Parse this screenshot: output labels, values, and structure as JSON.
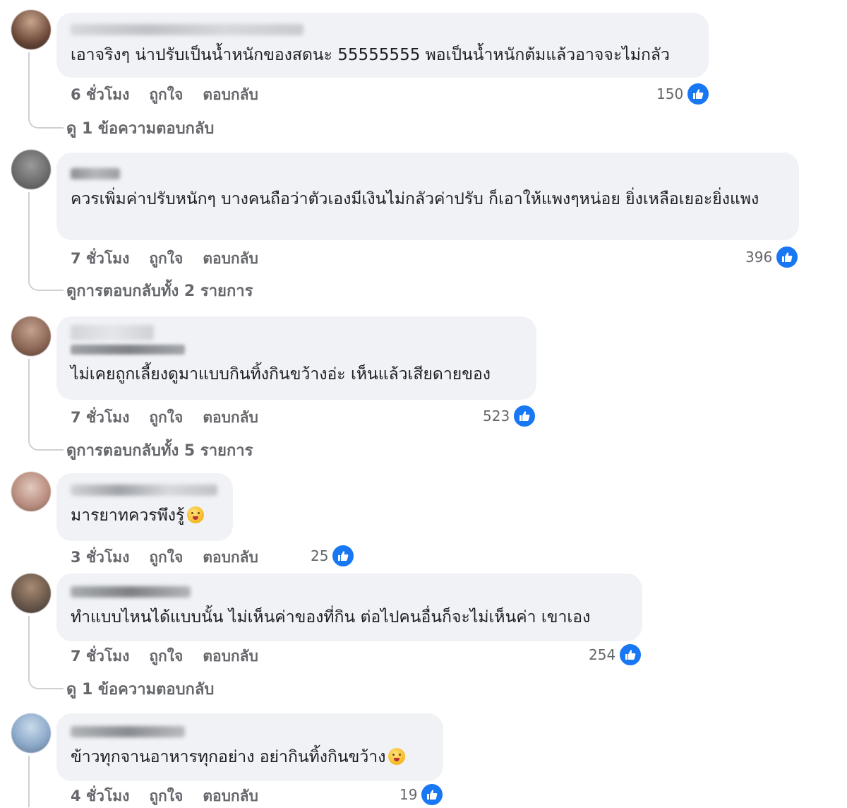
{
  "colors": {
    "like_blue": "#1877f2",
    "bubble": "#f0f2f5",
    "muted": "#65676b"
  },
  "comments": [
    {
      "text": "เอาจริงๆ น่าปรับเป็นน้ำหนักของสดนะ 55555555 พอเป็นน้ำหนักต้มแล้วอาจจะไม่กลัว",
      "time": "6 ชั่วโมง",
      "like": "ถูกใจ",
      "reply": "ตอบกลับ",
      "likes": "150",
      "replies": "ดู 1 ข้อความตอบกลับ"
    },
    {
      "text": "ควรเพิ่มค่าปรับหนักๆ บางคนถือว่าตัวเองมีเงินไม่กลัวค่าปรับ ก็เอาให้แพงๆหน่อย ยิ่งเหลือเยอะยิ่งแพง",
      "time": "7 ชั่วโมง",
      "like": "ถูกใจ",
      "reply": "ตอบกลับ",
      "likes": "396",
      "replies": "ดูการตอบกลับทั้ง 2 รายการ"
    },
    {
      "text": "ไม่เคยถูกเลี้ยงดูมาแบบกินทิ้งกินขว้างอ่ะ เห็นแล้วเสียดายของ",
      "time": "7 ชั่วโมง",
      "like": "ถูกใจ",
      "reply": "ตอบกลับ",
      "likes": "523",
      "replies": "ดูการตอบกลับทั้ง 5 รายการ"
    },
    {
      "text": "มารยาทควรพึงรู้",
      "time": "3 ชั่วโมง",
      "like": "ถูกใจ",
      "reply": "ตอบกลับ",
      "likes": "25"
    },
    {
      "text": "ทำแบบไหนได้แบบนั้น ไม่เห็นค่าของที่กิน ต่อไปคนอื่นก็จะไม่เห็นค่า เขาเอง",
      "time": "7 ชั่วโมง",
      "like": "ถูกใจ",
      "reply": "ตอบกลับ",
      "likes": "254",
      "replies": "ดู 1 ข้อความตอบกลับ"
    },
    {
      "text": "ข้าวทุกจานอาหารทุกอย่าง อย่ากินทิ้งกินขว้าง",
      "time": "4 ชั่วโมง",
      "like": "ถูกใจ",
      "reply": "ตอบกลับ",
      "likes": "19"
    }
  ]
}
